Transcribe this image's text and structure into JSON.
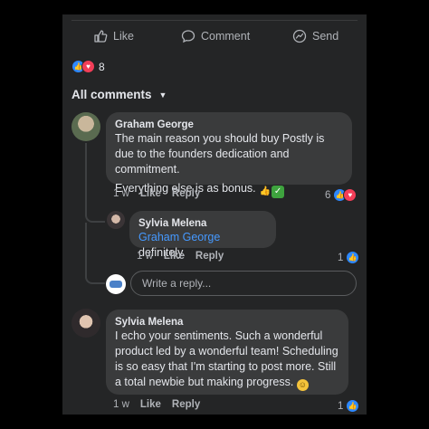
{
  "actions": {
    "like": "Like",
    "comment": "Comment",
    "send": "Send"
  },
  "reactions": {
    "count": "8"
  },
  "all_comments": {
    "label": "All comments"
  },
  "comments": [
    {
      "author": "Graham George",
      "line1": "The main reason you should buy Postly is due to the founders dedication and commitment.",
      "line2": "Everything else is as bonus.",
      "time": "1 w",
      "like": "Like",
      "reply": "Reply",
      "reactions": "6"
    }
  ],
  "reply": {
    "author": "Sylvia Melena",
    "mention": "Graham George",
    "text": " definitely.",
    "time": "1 w",
    "like": "Like",
    "reply": "Reply",
    "reactions": "1"
  },
  "reply_input": {
    "placeholder": "Write a reply..."
  },
  "comment2": {
    "author": "Sylvia Melena",
    "text": "I echo your sentiments. Such a wonderful product led by a wonderful team! Scheduling is so easy that I'm starting to post more.  Still a total newbie but making progress.",
    "time": "1 w",
    "like": "Like",
    "reply": "Reply",
    "reactions": "1"
  },
  "colors": {
    "panel": "#242526",
    "bubble": "#3a3b3c",
    "link": "#4599ff",
    "like_blue": "#2d88ff",
    "heart_red": "#f33e58"
  }
}
